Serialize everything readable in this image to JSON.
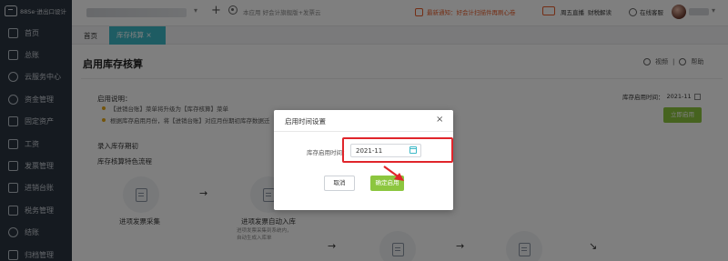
{
  "sidebar": {
    "logo_text": "88Se·进出口设计",
    "items": [
      {
        "label": "首页",
        "icon": "home-icon"
      },
      {
        "label": "总账",
        "icon": "ledger-icon"
      },
      {
        "label": "云服务中心",
        "icon": "cloud-icon"
      },
      {
        "label": "资金管理",
        "icon": "money-icon"
      },
      {
        "label": "固定资产",
        "icon": "asset-icon"
      },
      {
        "label": "工资",
        "icon": "salary-icon"
      },
      {
        "label": "发票管理",
        "icon": "invoice-icon"
      },
      {
        "label": "进销台账",
        "icon": "inventory-icon"
      },
      {
        "label": "税务管理",
        "icon": "tax-icon"
      },
      {
        "label": "结账",
        "icon": "checkout-icon"
      },
      {
        "label": "归档管理",
        "icon": "archive-icon"
      }
    ]
  },
  "topbar": {
    "dropdown": "▾",
    "plus": "+",
    "partner_text": "本应用 好会计旗舰版+发票云",
    "notice_text": "最新通知：好会计扫描件再刷心卷",
    "live_label": "周五直播",
    "finance_label": "财税解读",
    "service_label": "在线客服",
    "user_arrow": "▾"
  },
  "tabs": {
    "home": "首页",
    "active": "库存核算 ×"
  },
  "page": {
    "title": "启用库存核算",
    "video_label": "视频",
    "separator": "|",
    "help_label": "帮助",
    "intro_title": "启用说明：",
    "bullets": [
      "【进销台账】菜单将升级为【库存核算】菜单",
      "根据库存启用月份，将【进销台账】对应月份期初库存数据迁"
    ],
    "start_month_label": "库存启用时间：",
    "start_month_value": "2021-11",
    "enable_button": "立即启用",
    "section1": "录入库存期初",
    "section2": "库存核算特色流程",
    "flow": [
      {
        "label": "进项发票采集"
      },
      {
        "label": "进项发票自动入库",
        "sub": "进项发票采集到系统内，自动生成入库单"
      }
    ],
    "arrow": "→",
    "arrow_diag": "↘"
  },
  "dialog": {
    "title": "启用时间设置",
    "close": "×",
    "field_label": "库存启用时间：",
    "field_value": "2021-11",
    "cancel": "取消",
    "confirm": "确定启用"
  },
  "colors": {
    "sidebar_bg": "#2b3440",
    "accent": "#3cb9c7",
    "primary_button": "#8cc63f",
    "highlight_red": "#e0252b",
    "notice": "#e85d2a"
  }
}
